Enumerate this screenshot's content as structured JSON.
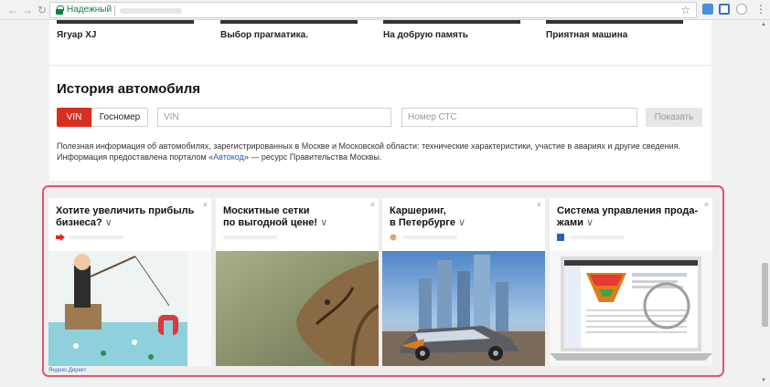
{
  "browser": {
    "back_icon": "arrow-left-icon",
    "forward_icon": "arrow-right-icon",
    "reload_icon": "reload-icon",
    "secure_label": "Надежный",
    "bookmark_icon": "star-icon",
    "menu_icon": "kebab-icon"
  },
  "cars": {
    "items": [
      {
        "title": "Ягуар XJ"
      },
      {
        "title": "Выбор прагматика."
      },
      {
        "title": "На добрую память"
      },
      {
        "title": "Приятная машина"
      }
    ]
  },
  "history": {
    "title": "История автомобиля",
    "tab_vin": "VIN",
    "tab_gosnomer": "Госномер",
    "vin_placeholder": "VIN",
    "sts_placeholder": "Номер СТС",
    "show_button": "Показать",
    "info_line1": "Полезная информация об автомобилях, зарегистрированных в Москве и Московской области: технические характеристики, участие в авариях и другие сведения.",
    "info_line2_prefix": "Информация предоставлена порталом «",
    "info_link": "Автокод",
    "info_line2_suffix": "» — ресурс Правительства Москвы."
  },
  "ads": {
    "close_symbol": "×",
    "chevron": "∨",
    "items": [
      {
        "line1": "Хотите увеличить прибыль",
        "line2": "бизнеса?",
        "icon": "red-arrow-icon",
        "icon_color": "#e0261b"
      },
      {
        "line1": "Москитные сетки",
        "line2": "по выгодной цене!",
        "icon": "none"
      },
      {
        "line1": "Каршеринг,",
        "line2": "в Петербурге",
        "icon": "hand-icon",
        "icon_color": "#e8a26a"
      },
      {
        "line1": "Система управления прода-",
        "line2": "жами",
        "icon": "blue-flag-icon",
        "icon_color": "#2b5fb8"
      }
    ],
    "direct_label": "Яндекс.Директ"
  },
  "colors": {
    "accent_red": "#d73021",
    "ad_border": "#e05570",
    "link_blue": "#1a5fb4",
    "secure_green": "#0b8043"
  }
}
